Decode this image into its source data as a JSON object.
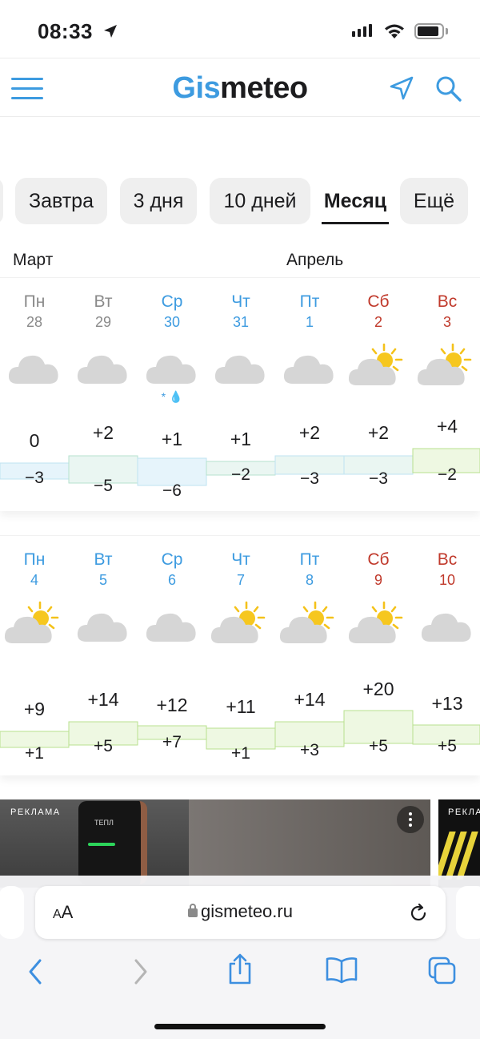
{
  "status": {
    "time": "08:33"
  },
  "header": {
    "logo_part1": "Gis",
    "logo_part2": "meteo"
  },
  "tabs": [
    {
      "label": "Завтра",
      "active": false
    },
    {
      "label": "3 дня",
      "active": false
    },
    {
      "label": "10 дней",
      "active": false
    },
    {
      "label": "Месяц",
      "active": true
    },
    {
      "label": "Ещё",
      "active": false
    }
  ],
  "months": {
    "left": "Март",
    "right": "Апрель"
  },
  "weeks": [
    {
      "days": [
        {
          "dow": "Пн",
          "date": "28",
          "kind": "past",
          "icon": "cloud-icon",
          "max": "0",
          "min": "−3",
          "precip": ""
        },
        {
          "dow": "Вт",
          "date": "29",
          "kind": "past",
          "icon": "cloud-icon",
          "max": "+2",
          "min": "−5",
          "precip": ""
        },
        {
          "dow": "Ср",
          "date": "30",
          "kind": "weekday",
          "icon": "cloud-icon",
          "max": "+1",
          "min": "−6",
          "precip": "* 💧"
        },
        {
          "dow": "Чт",
          "date": "31",
          "kind": "weekday",
          "icon": "cloud-icon",
          "max": "+1",
          "min": "−2",
          "precip": ""
        },
        {
          "dow": "Пт",
          "date": "1",
          "kind": "weekday",
          "icon": "cloud-icon",
          "max": "+2",
          "min": "−3",
          "precip": ""
        },
        {
          "dow": "Сб",
          "date": "2",
          "kind": "weekend",
          "icon": "sun-cloud-icon",
          "max": "+2",
          "min": "−3",
          "precip": ""
        },
        {
          "dow": "Вс",
          "date": "3",
          "kind": "weekend",
          "icon": "sun-cloud-icon",
          "max": "+4",
          "min": "−2",
          "precip": ""
        }
      ]
    },
    {
      "days": [
        {
          "dow": "Пн",
          "date": "4",
          "kind": "weekday",
          "icon": "sun-cloud-icon",
          "max": "+9",
          "min": "+1",
          "precip": ""
        },
        {
          "dow": "Вт",
          "date": "5",
          "kind": "weekday",
          "icon": "cloud-icon",
          "max": "+14",
          "min": "+5",
          "precip": ""
        },
        {
          "dow": "Ср",
          "date": "6",
          "kind": "weekday",
          "icon": "cloud-icon",
          "max": "+12",
          "min": "+7",
          "precip": ""
        },
        {
          "dow": "Чт",
          "date": "7",
          "kind": "weekday",
          "icon": "sun-cloud-icon",
          "max": "+11",
          "min": "+1",
          "precip": ""
        },
        {
          "dow": "Пт",
          "date": "8",
          "kind": "weekday",
          "icon": "sun-cloud-icon",
          "max": "+14",
          "min": "+3",
          "precip": ""
        },
        {
          "dow": "Сб",
          "date": "9",
          "kind": "weekend",
          "icon": "sun-cloud-icon",
          "max": "+20",
          "min": "+5",
          "precip": ""
        },
        {
          "dow": "Вс",
          "date": "10",
          "kind": "weekend",
          "icon": "cloud-icon",
          "max": "+13",
          "min": "+5",
          "precip": ""
        }
      ]
    }
  ],
  "ad": {
    "label": "РЕКЛАМА",
    "brand": "ТЕПЛ",
    "label2": "РЕКЛА"
  },
  "browser": {
    "text_size": "AA",
    "url": "gismeteo.ru"
  },
  "colors": {
    "accent": "#3d9be0",
    "weekend": "#c0392b",
    "past": "#8a8a8a"
  }
}
